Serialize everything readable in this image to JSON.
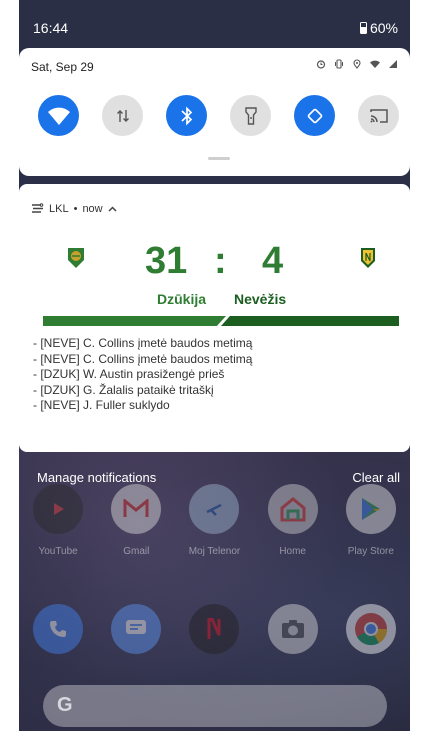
{
  "status_bar": {
    "time": "16:44",
    "battery": "60%"
  },
  "quick_settings": {
    "date": "Sat, Sep 29",
    "tiles": [
      {
        "name": "wifi",
        "state": "on"
      },
      {
        "name": "mobile-data",
        "state": "off"
      },
      {
        "name": "bluetooth",
        "state": "on"
      },
      {
        "name": "flashlight",
        "state": "off"
      },
      {
        "name": "auto-rotate",
        "state": "on"
      },
      {
        "name": "cast",
        "state": "off"
      }
    ]
  },
  "notification": {
    "app": "LKL",
    "time": "now",
    "score_a": "31",
    "separator": ":",
    "score_b": "4",
    "team_a": "Dzūkija",
    "team_b": "Nevėžis",
    "events": [
      "- [NEVE] C. Collins įmetė baudos metimą",
      "- [NEVE] C. Collins įmetė baudos metimą",
      "- [DZUK] W. Austin prasižengė prieš",
      "- [DZUK] G. Žalalis pataikė tritaškį",
      "- [NEVE] J. Fuller suklydo"
    ]
  },
  "footer": {
    "manage": "Manage notifications",
    "clear": "Clear all"
  },
  "apps_row1": [
    {
      "label": "YouTube",
      "color": "#2a2a2a"
    },
    {
      "label": "Gmail",
      "color": "#e0e0e0"
    },
    {
      "label": "Moj Telenor",
      "color": "#9fb8d0"
    },
    {
      "label": "Home",
      "color": "#d0d0d0"
    },
    {
      "label": "Play Store",
      "color": "#e8e8e8"
    }
  ],
  "apps_row2": [
    {
      "name": "phone",
      "color": "#4285f4"
    },
    {
      "name": "messages",
      "color": "#5e97f6"
    },
    {
      "name": "netflix",
      "color": "#221f1f"
    },
    {
      "name": "camera",
      "color": "#dcdcdc"
    },
    {
      "name": "chrome",
      "color": "#ffffff"
    }
  ],
  "search": {
    "glyph": "G"
  }
}
